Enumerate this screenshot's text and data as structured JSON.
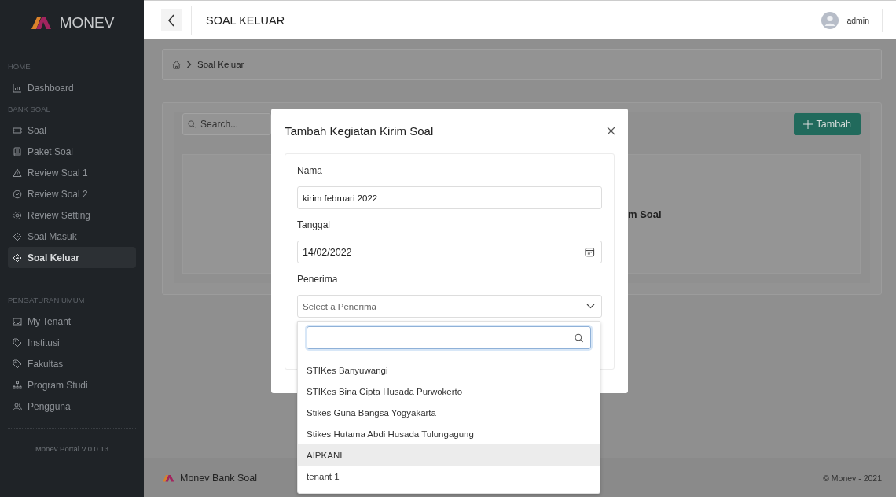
{
  "sidebar": {
    "brand": "MONEV",
    "sections": [
      {
        "heading": "HOME",
        "items": [
          {
            "label": "Dashboard",
            "selected": false
          }
        ]
      },
      {
        "heading": "BANK SOAL",
        "items": [
          {
            "label": "Soal",
            "selected": false
          },
          {
            "label": "Paket Soal",
            "selected": false
          },
          {
            "label": "Review Soal 1",
            "selected": false
          },
          {
            "label": "Review Soal 2",
            "selected": false
          },
          {
            "label": "Review Setting",
            "selected": false
          },
          {
            "label": "Soal Masuk",
            "selected": false
          },
          {
            "label": "Soal Keluar",
            "selected": true
          }
        ]
      },
      {
        "heading": "PENGATURAN UMUM",
        "items": [
          {
            "label": "My Tenant",
            "selected": false
          },
          {
            "label": "Institusi",
            "selected": false
          },
          {
            "label": "Fakultas",
            "selected": false
          },
          {
            "label": "Program Studi",
            "selected": false
          },
          {
            "label": "Pengguna",
            "selected": false
          }
        ]
      }
    ],
    "version": "Monev Portal V.0.0.13"
  },
  "header": {
    "title": "SOAL KELUAR",
    "user": "admin"
  },
  "breadcrumb": [
    "Soal Keluar"
  ],
  "toolbar": {
    "search_placeholder": "Search...",
    "add_button": "Tambah"
  },
  "table": {
    "visible_text": "m Soal"
  },
  "footer": {
    "brand": "Monev Bank Soal",
    "copyright": "© Monev - 2021"
  },
  "modal": {
    "title": "Tambah Kegiatan Kirim Soal",
    "fields": [
      {
        "kind": "text",
        "label": "Nama",
        "value": "kirim februari 2022"
      },
      {
        "kind": "date",
        "label": "Tanggal",
        "value": "14/02/2022"
      },
      {
        "kind": "select",
        "label": "Penerima",
        "placeholder": "Select a Penerima"
      }
    ],
    "dropdown": {
      "options": [
        {
          "label": "STIKes Banyuwangi",
          "selected": false
        },
        {
          "label": "STIKes Bina Cipta Husada Purwokerto",
          "selected": false
        },
        {
          "label": "Stikes Guna Bangsa Yogyakarta",
          "selected": false
        },
        {
          "label": "Stikes Hutama Abdi Husada Tulungagung",
          "selected": false
        },
        {
          "label": "AIPKANI",
          "selected": true
        },
        {
          "label": "tenant 1",
          "selected": false
        }
      ]
    }
  }
}
